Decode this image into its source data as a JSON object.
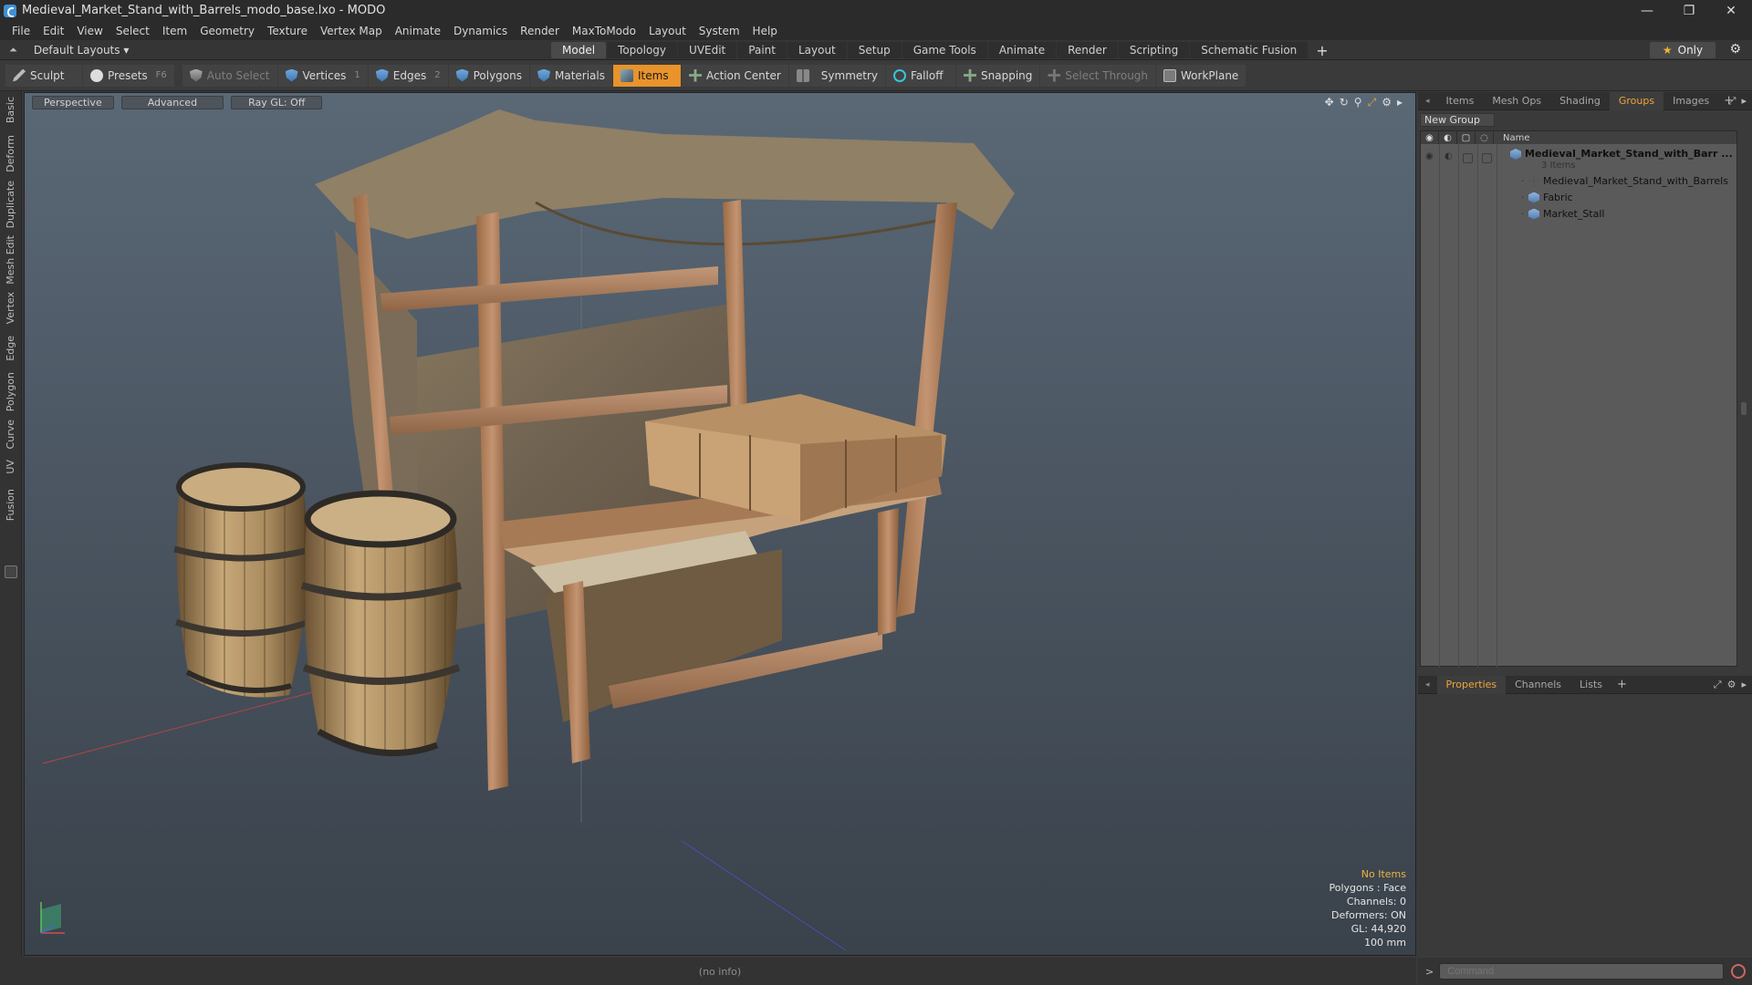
{
  "window": {
    "title": "Medieval_Market_Stand_with_Barrels_modo_base.lxo - MODO",
    "minimize": "—",
    "restore": "❐",
    "close": "✕"
  },
  "menu": [
    "File",
    "Edit",
    "View",
    "Select",
    "Item",
    "Geometry",
    "Texture",
    "Vertex Map",
    "Animate",
    "Dynamics",
    "Render",
    "MaxToModo",
    "Layout",
    "System",
    "Help"
  ],
  "layouts": {
    "label": "Default Layouts ▾"
  },
  "mode_tabs": [
    "Model",
    "Topology",
    "UVEdit",
    "Paint",
    "Layout",
    "Setup",
    "Game Tools",
    "Animate",
    "Render",
    "Scripting",
    "Schematic Fusion"
  ],
  "mode_tab_active": "Model",
  "mode_plus": "+",
  "only_button": {
    "star": "★",
    "label": "Only"
  },
  "toolbar": {
    "sculpt": "Sculpt",
    "presets": "Presets",
    "presets_key": "F6",
    "auto_select": "Auto Select",
    "vertices": "Vertices",
    "vertices_key": "1",
    "edges": "Edges",
    "edges_key": "2",
    "polygons": "Polygons",
    "materials": "Materials",
    "items": "Items",
    "action_center": "Action Center",
    "symmetry": "Symmetry",
    "falloff": "Falloff",
    "snapping": "Snapping",
    "select_through": "Select Through",
    "workplane": "WorkPlane"
  },
  "left_tabs": [
    "Basic",
    "Deform",
    "Duplicate",
    "Mesh Edit",
    "Vertex",
    "Edge",
    "Polygon",
    "Curve",
    "UV",
    "Fusion"
  ],
  "viewport": {
    "view_mode": "Perspective",
    "shading": "Advanced",
    "raygl": "Ray GL: Off",
    "info": {
      "selection": "No Items",
      "polygons": "Polygons : Face",
      "channels": "Channels: 0",
      "deformers": "Deformers: ON",
      "gl": "GL: 44,920",
      "scale": "100 mm"
    }
  },
  "right_panel": {
    "top_tabs": [
      "Items",
      "Mesh Ops",
      "Shading",
      "Groups",
      "Images"
    ],
    "top_active": "Groups",
    "new_group": "New Group",
    "column_name": "Name",
    "group": {
      "name": "Medieval_Market_Stand_with_Barr ...",
      "count": "3 Items",
      "children": [
        "Medieval_Market_Stand_with_Barrels",
        "Fabric",
        "Market_Stall"
      ]
    },
    "bottom_tabs": [
      "Properties",
      "Channels",
      "Lists"
    ],
    "bottom_active": "Properties"
  },
  "status": {
    "info": "(no info)"
  },
  "command": {
    "placeholder": "Command"
  }
}
